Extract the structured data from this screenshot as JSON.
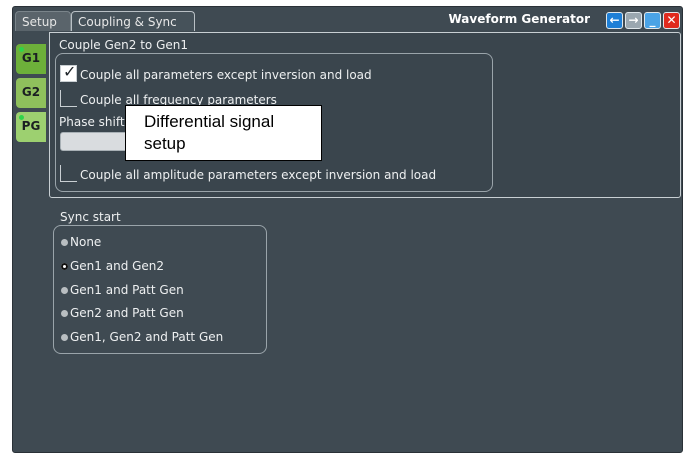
{
  "window": {
    "title": "Waveform Generator",
    "tabs": [
      {
        "label": "Setup"
      },
      {
        "label": "Coupling & Sync"
      }
    ],
    "buttons": {
      "back": "←",
      "forward": "→",
      "minimize": "_",
      "close": "✕"
    },
    "colors": {
      "back": "#1e7fd6",
      "forward": "#9aa7b0",
      "minimize": "#4aa3e6",
      "close": "#e02a1e"
    }
  },
  "side_tabs": [
    {
      "label": "G1"
    },
    {
      "label": "G2"
    },
    {
      "label": "PG"
    }
  ],
  "coupling": {
    "heading": "Couple Gen2 to Gen1",
    "options": [
      {
        "label": "Couple all parameters except inversion and load",
        "checked": true
      },
      {
        "label": "Couple all frequency parameters",
        "checked": false
      }
    ],
    "phase_label": "Phase shift",
    "amplitude": {
      "label": "Couple all amplitude parameters except inversion and load",
      "checked": false
    }
  },
  "callout": {
    "line1": "Differential signal",
    "line2": "setup"
  },
  "sync": {
    "heading": "Sync start",
    "options": [
      {
        "label": "None",
        "selected": false
      },
      {
        "label": "Gen1 and Gen2",
        "selected": true
      },
      {
        "label": "Gen1 and Patt Gen",
        "selected": false
      },
      {
        "label": "Gen2 and Patt Gen",
        "selected": false
      },
      {
        "label": "Gen1, Gen2 and Patt Gen",
        "selected": false
      }
    ]
  }
}
